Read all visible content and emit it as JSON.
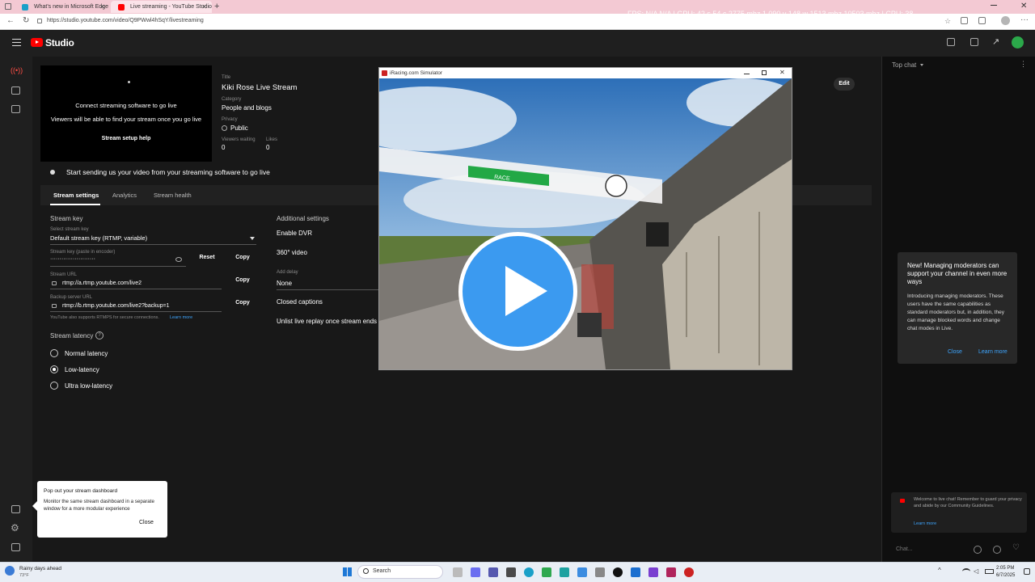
{
  "browser": {
    "tabs": [
      {
        "title": "What's new in Microsoft Edge"
      },
      {
        "title": "Live streaming - YouTube Studio"
      }
    ],
    "url": "https://studio.youtube.com/video/Q9PWwl4hSqY/livestreaming",
    "perf_overlay": "FPS: N/A  N/A  |  GPU: 42 s  54 c  2775 mhz  1,090 v  148 w  1513 mhz  10503 mhz  |  CPU: 38"
  },
  "header": {
    "app_name": "Studio"
  },
  "stream": {
    "preview_line1": "Connect streaming software to go live",
    "preview_line2": "Viewers will be able to find your stream once you go live",
    "setup_help": "Stream setup help",
    "title_label": "Title",
    "title_value": "Kiki Rose Live Stream",
    "category_label": "Category",
    "category_value": "People and blogs",
    "privacy_label": "Privacy",
    "privacy_value": "Public",
    "viewers_label": "Viewers waiting",
    "viewers_value": "0",
    "likes_label": "Likes",
    "likes_value": "0",
    "edit": "Edit",
    "status": "Start sending us your video from your streaming software to go live"
  },
  "tabs": [
    {
      "label": "Stream settings"
    },
    {
      "label": "Analytics"
    },
    {
      "label": "Stream health"
    }
  ],
  "settings": {
    "stream_key_heading": "Stream key",
    "select_key_label": "Select stream key",
    "select_key_value": "Default stream key (RTMP, variable)",
    "key_label": "Stream key (paste in encoder)",
    "key_value": "························",
    "reset": "Reset",
    "copy": "Copy",
    "url_label": "Stream URL",
    "url_value": "rtmp://a.rtmp.youtube.com/live2",
    "backup_label": "Backup server URL",
    "backup_value": "rtmp://b.rtmp.youtube.com/live2?backup=1",
    "rtmps_note": "YouTube also supports RTMPS for secure connections.",
    "learn_more": "Learn more",
    "latency_heading": "Stream latency",
    "latency_options": [
      {
        "label": "Normal latency",
        "selected": false
      },
      {
        "label": "Low-latency",
        "selected": true
      },
      {
        "label": "Ultra low-latency",
        "selected": false
      }
    ]
  },
  "additional": {
    "heading": "Additional settings",
    "dvr": "Enable DVR",
    "video360": "360° video",
    "delay_label": "Add delay",
    "delay_value": "None",
    "captions": "Closed captions",
    "unlist": "Unlist live replay once stream ends"
  },
  "popout_tip": {
    "title": "Pop out your stream dashboard",
    "body": "Monitor the same stream dashboard in a separate window for a more modular experience",
    "close": "Close"
  },
  "chat": {
    "mode": "Top chat",
    "mod_title": "New! Managing moderators can support your channel in even more ways",
    "mod_body": "Introducing managing moderators. These users have the same capabilities as standard moderators but, in addition, they can manage blocked words and change chat modes in Live.",
    "mod_close": "Close",
    "mod_learn": "Learn more",
    "welcome": "Welcome to live chat! Remember to guard your privacy and abide by our Community Guidelines.",
    "welcome_learn": "Learn more",
    "input_placeholder": "Chat..."
  },
  "sim_window": {
    "title": "iRacing.com Simulator",
    "race_label": "RACE"
  },
  "taskbar": {
    "weather_title": "Rainy days ahead",
    "weather_temp": "73°F",
    "search": "Search",
    "time": "2:05 PM",
    "date": "6/7/2025"
  },
  "colors": {
    "yt_red": "#ff0000",
    "play_blue": "#3b9af0",
    "link_blue": "#3ea6ff"
  }
}
